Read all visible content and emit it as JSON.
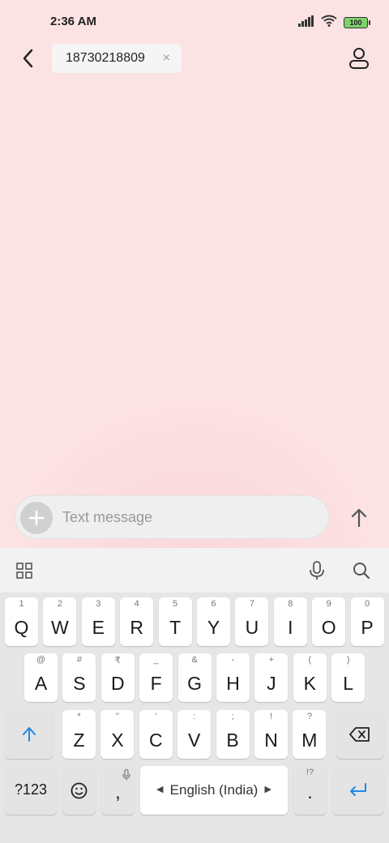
{
  "status": {
    "time": "2:36 AM",
    "battery": "100"
  },
  "header": {
    "recipient": "18730218809",
    "clear_symbol": "×"
  },
  "compose": {
    "placeholder": "Text message"
  },
  "keyboard": {
    "row1": [
      {
        "hint": "1",
        "label": "Q"
      },
      {
        "hint": "2",
        "label": "W"
      },
      {
        "hint": "3",
        "label": "E"
      },
      {
        "hint": "4",
        "label": "R"
      },
      {
        "hint": "5",
        "label": "T"
      },
      {
        "hint": "6",
        "label": "Y"
      },
      {
        "hint": "7",
        "label": "U"
      },
      {
        "hint": "8",
        "label": "I"
      },
      {
        "hint": "9",
        "label": "O"
      },
      {
        "hint": "0",
        "label": "P"
      }
    ],
    "row2": [
      {
        "hint": "@",
        "label": "A"
      },
      {
        "hint": "#",
        "label": "S"
      },
      {
        "hint": "₹",
        "label": "D"
      },
      {
        "hint": "_",
        "label": "F"
      },
      {
        "hint": "&",
        "label": "G"
      },
      {
        "hint": "-",
        "label": "H"
      },
      {
        "hint": "+",
        "label": "J"
      },
      {
        "hint": "(",
        "label": "K"
      },
      {
        "hint": ")",
        "label": "L"
      }
    ],
    "row3": [
      {
        "hint": "*",
        "label": "Z"
      },
      {
        "hint": "\"",
        "label": "X"
      },
      {
        "hint": "'",
        "label": "C"
      },
      {
        "hint": ":",
        "label": "V"
      },
      {
        "hint": ";",
        "label": "B"
      },
      {
        "hint": "!",
        "label": "N"
      },
      {
        "hint": "?",
        "label": "M"
      }
    ],
    "symbols_label": "?123",
    "comma_label": ",",
    "space_label": "English (India)",
    "period_label": ".",
    "period_hint": "!?",
    "accent_color": "#1e88e5"
  }
}
